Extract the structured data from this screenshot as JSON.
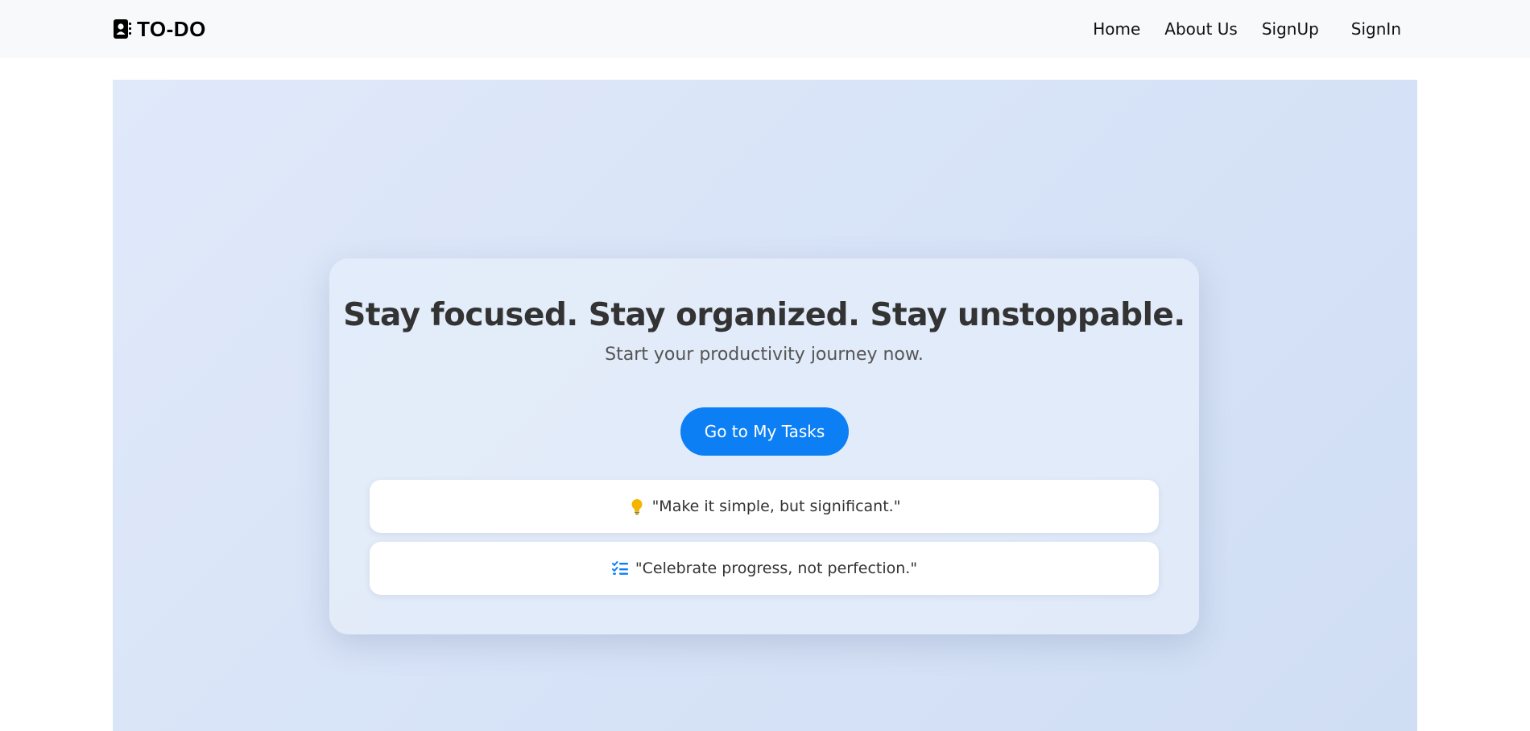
{
  "brand": {
    "name": "TO-DO",
    "icon": "address-book-icon"
  },
  "nav": {
    "items": [
      {
        "label": "Home"
      },
      {
        "label": "About Us"
      },
      {
        "label": "SignUp"
      },
      {
        "label": "SignIn"
      }
    ]
  },
  "hero": {
    "headline": "Stay focused. Stay organized. Stay unstoppable.",
    "subheadline": "Start your productivity journey now.",
    "cta_label": "Go to My Tasks",
    "quotes": [
      {
        "icon": "lightbulb-icon",
        "text": "\"Make it simple, but significant.\""
      },
      {
        "icon": "checklist-icon",
        "text": "\"Celebrate progress, not perfection.\""
      }
    ]
  },
  "colors": {
    "accent": "#0d7ff5",
    "navbar_bg": "#f8f9fa",
    "hero_bg": "#dbe5f8",
    "lightbulb": "#f5b400"
  }
}
